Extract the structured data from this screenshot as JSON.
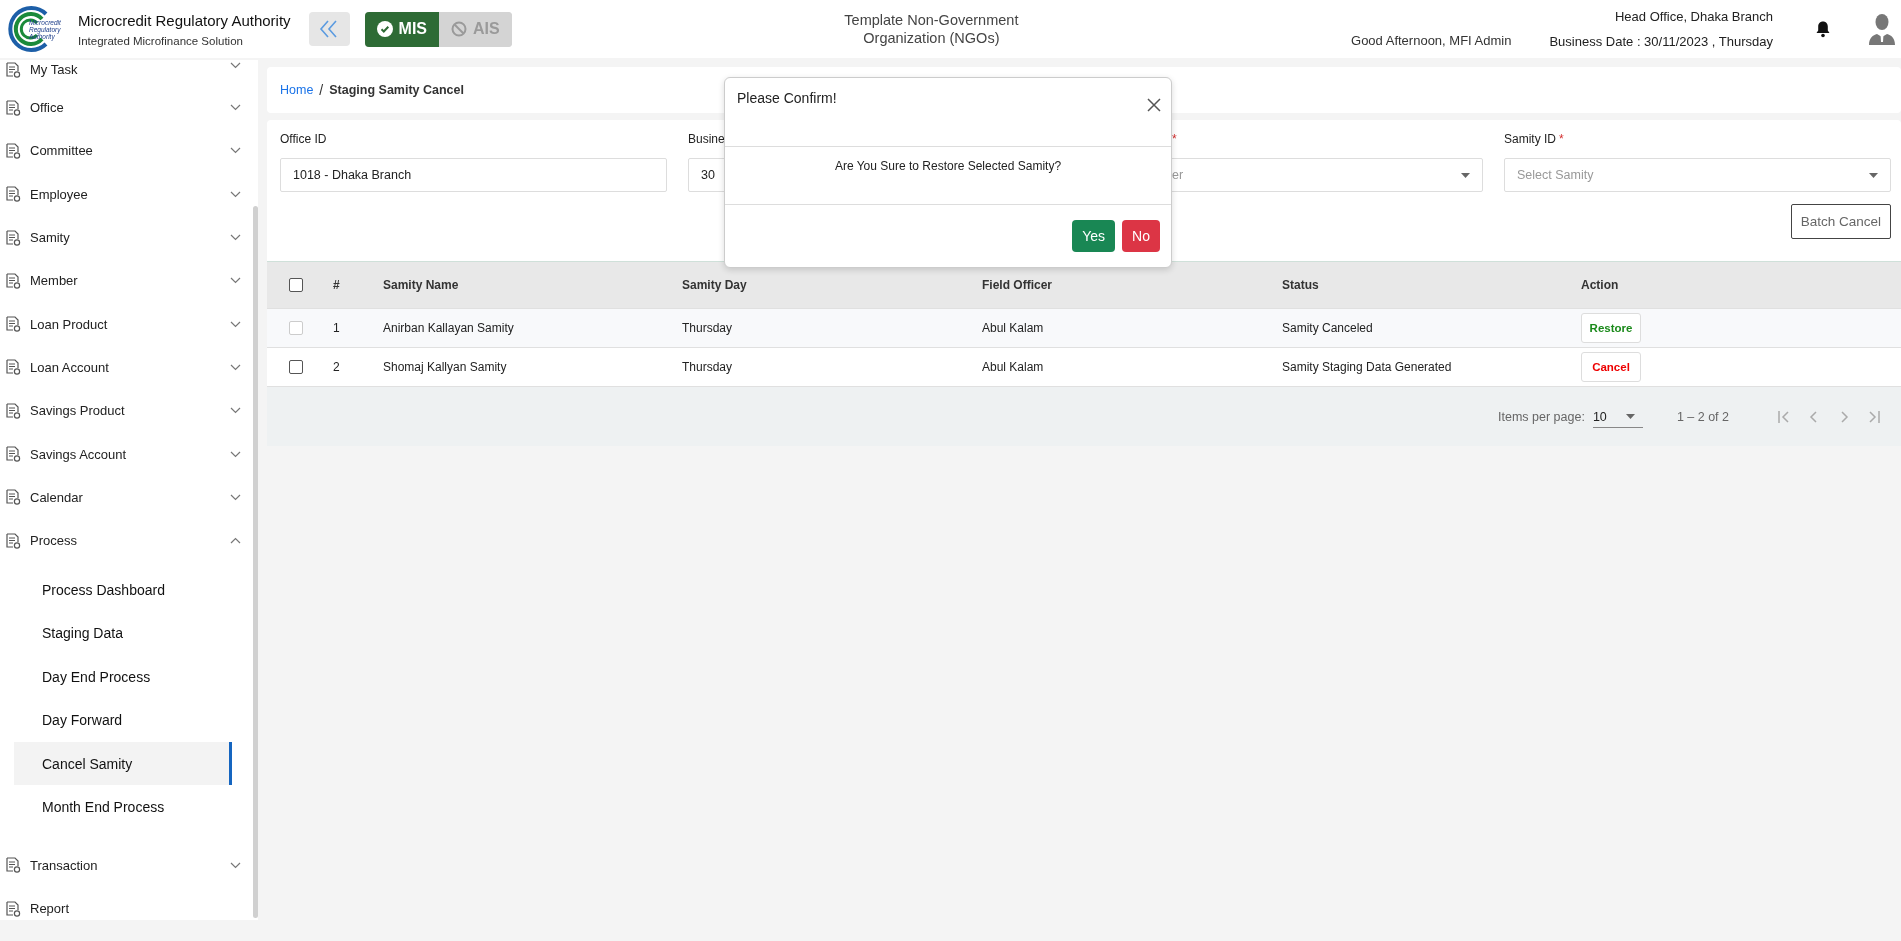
{
  "header": {
    "logo_text": [
      "Microcredit",
      "Regulatory",
      "Authority"
    ],
    "title": "Microcredit Regulatory Authority",
    "subtitle": "Integrated Microfinance Solution",
    "modules": [
      {
        "label": "MIS",
        "selected": true
      },
      {
        "label": "AIS",
        "selected": false
      }
    ],
    "organization": "Template Non-Government Organization (NGOs)",
    "greeting": "Good Afternoon, MFI Admin",
    "office": "Head Office, Dhaka Branch",
    "business_date": "Business Date : 30/11/2023 , Thursday"
  },
  "sidebar": {
    "items": [
      {
        "label": "My Task",
        "kind": "group",
        "expanded": false
      },
      {
        "label": "Office",
        "kind": "group",
        "expanded": false
      },
      {
        "label": "Committee",
        "kind": "group",
        "expanded": false
      },
      {
        "label": "Employee",
        "kind": "group",
        "expanded": false
      },
      {
        "label": "Samity",
        "kind": "group",
        "expanded": false
      },
      {
        "label": "Member",
        "kind": "group",
        "expanded": false
      },
      {
        "label": "Loan Product",
        "kind": "group",
        "expanded": false
      },
      {
        "label": "Loan Account",
        "kind": "group",
        "expanded": false
      },
      {
        "label": "Savings Product",
        "kind": "group",
        "expanded": false
      },
      {
        "label": "Savings Account",
        "kind": "group",
        "expanded": false
      },
      {
        "label": "Calendar",
        "kind": "group",
        "expanded": false
      },
      {
        "label": "Process",
        "kind": "group",
        "expanded": true,
        "children": [
          {
            "label": "Process Dashboard",
            "selected": false
          },
          {
            "label": "Staging Data",
            "selected": false
          },
          {
            "label": "Day End Process",
            "selected": false
          },
          {
            "label": "Day Forward",
            "selected": false
          },
          {
            "label": "Cancel Samity",
            "selected": true
          },
          {
            "label": "Month End Process",
            "selected": false
          }
        ]
      },
      {
        "label": "Transaction",
        "kind": "group",
        "expanded": false
      },
      {
        "label": "Report",
        "kind": "link"
      }
    ]
  },
  "breadcrumb": {
    "home": "Home",
    "separator": "/",
    "current": "Staging Samity Cancel"
  },
  "form": {
    "fields": [
      {
        "label": "Office ID",
        "value": "1018 - Dhaka Branch",
        "kind": "text"
      },
      {
        "label": "Busine",
        "value": "30",
        "kind": "text"
      },
      {
        "required": true,
        "required_mark": "*",
        "placeholder": "er",
        "kind": "select"
      },
      {
        "label": "Samity ID",
        "required": true,
        "required_mark": "*",
        "placeholder": "Select Samity",
        "kind": "select"
      }
    ],
    "batch_button": "Batch Cancel"
  },
  "table": {
    "select_all": {
      "checked": false
    },
    "columns": [
      "#",
      "Samity Name",
      "Samity Day",
      "Field Officer",
      "Status",
      "Action"
    ],
    "rows": [
      {
        "checked": false,
        "disabled": true,
        "cells": [
          "1",
          "Anirban Kallayan Samity",
          "Thursday",
          "Abul Kalam",
          "Samity Canceled"
        ],
        "action": {
          "label": "Restore",
          "kind": "restore"
        }
      },
      {
        "checked": false,
        "disabled": false,
        "cells": [
          "2",
          "Shomaj Kallyan Samity",
          "Thursday",
          "Abul Kalam",
          "Samity Staging Data Generated"
        ],
        "action": {
          "label": "Cancel",
          "kind": "cancel"
        }
      }
    ]
  },
  "paginator": {
    "items_per_page_label": "Items per page:",
    "page_size": "10",
    "range": "1 – 2 of 2"
  },
  "dialog": {
    "title": "Please Confirm!",
    "message": "Are You Sure to Restore Selected Samity?",
    "buttons": [
      {
        "label": "Yes",
        "kind": "confirm"
      },
      {
        "label": "No",
        "kind": "deny"
      }
    ]
  }
}
